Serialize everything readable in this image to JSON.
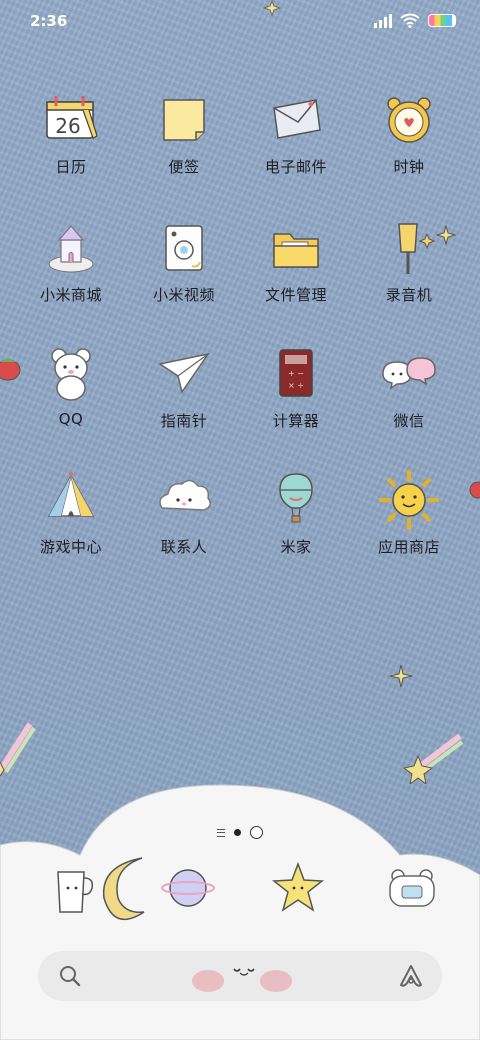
{
  "status_bar": {
    "time": "2:36"
  },
  "apps": [
    {
      "label": "日历",
      "icon": "calendar-icon",
      "date": "26"
    },
    {
      "label": "便签",
      "icon": "notes-icon"
    },
    {
      "label": "电子邮件",
      "icon": "email-icon"
    },
    {
      "label": "时钟",
      "icon": "clock-icon"
    },
    {
      "label": "小米商城",
      "icon": "store-castle-icon"
    },
    {
      "label": "小米视频",
      "icon": "video-icon"
    },
    {
      "label": "文件管理",
      "icon": "folder-icon"
    },
    {
      "label": "录音机",
      "icon": "recorder-icon"
    },
    {
      "label": "QQ",
      "icon": "bear-icon"
    },
    {
      "label": "指南针",
      "icon": "compass-paper-plane-icon"
    },
    {
      "label": "计算器",
      "icon": "calculator-icon"
    },
    {
      "label": "微信",
      "icon": "chat-bubbles-icon"
    },
    {
      "label": "游戏中心",
      "icon": "tent-icon"
    },
    {
      "label": "联系人",
      "icon": "contacts-cloud-icon"
    },
    {
      "label": "米家",
      "icon": "balloon-icon"
    },
    {
      "label": "应用商店",
      "icon": "sun-icon"
    }
  ],
  "dock": [
    {
      "icon": "phone-cup-icon"
    },
    {
      "icon": "moon-icon"
    },
    {
      "icon": "planet-icon"
    },
    {
      "icon": "star-icon"
    },
    {
      "icon": "camera-bear-icon"
    }
  ],
  "page_indicator": {
    "count": 2,
    "active": 1
  }
}
